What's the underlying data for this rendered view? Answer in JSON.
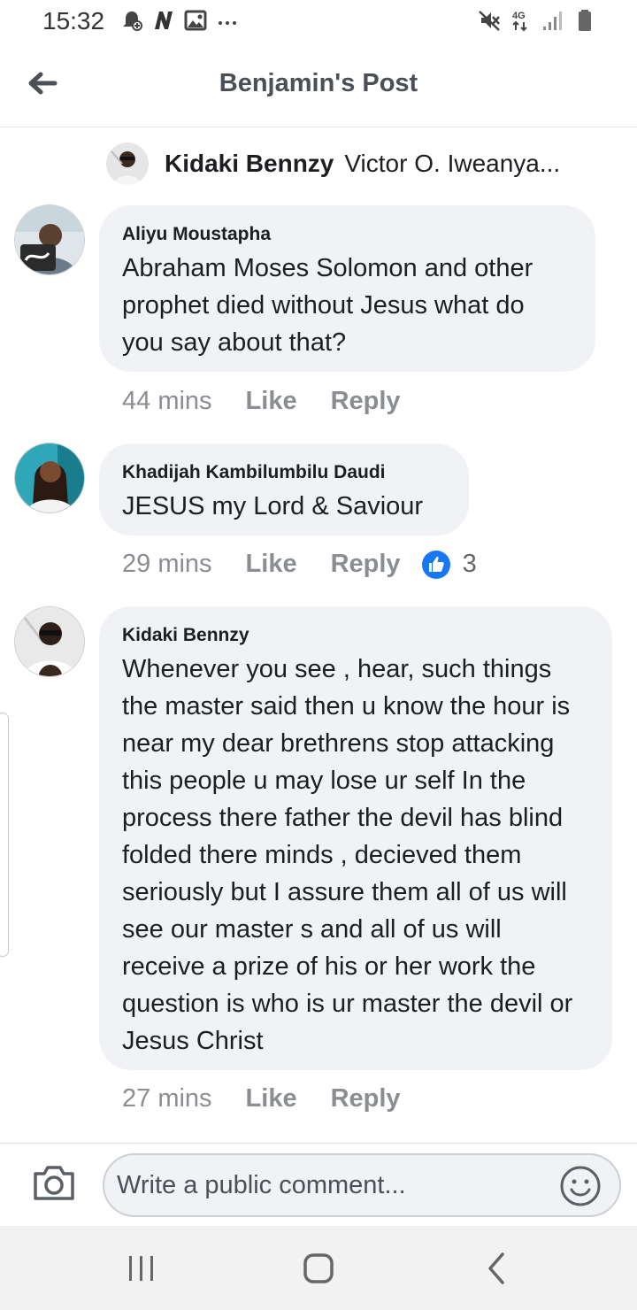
{
  "status_bar": {
    "time": "15:32",
    "left_icons": [
      "notification-icon",
      "n-logo-icon",
      "image-icon",
      "more-dots-icon"
    ],
    "right_icons": [
      "mute-icon",
      "network-4g-icon",
      "signal-icon",
      "battery-icon"
    ],
    "network_label": "4G"
  },
  "header": {
    "title": "Benjamin's Post"
  },
  "reply_preview": {
    "author": "Kidaki Bennzy",
    "text": "Victor O. Iweanya..."
  },
  "comments": [
    {
      "author": "Aliyu Moustapha",
      "text": "Abraham Moses Solomon and other prophet died without Jesus what do you say about that?",
      "time": "44 mins",
      "like_label": "Like",
      "reply_label": "Reply"
    },
    {
      "author": "Khadijah Kambilumbilu Daudi",
      "text": "JESUS my Lord & Saviour",
      "time": "29 mins",
      "like_label": "Like",
      "reply_label": "Reply",
      "reaction_count": "3"
    },
    {
      "author": "Kidaki Bennzy",
      "text": "Whenever you see , hear, such things the master said then u know the hour is near my dear brethrens stop attacking this people u may lose ur self In the process there father the devil has blind folded there minds , decieved them seriously but I assure them all of us will see our master s and all of us will receive a prize of his or her work the question is who is ur master the devil or Jesus Christ",
      "time": "27 mins",
      "like_label": "Like",
      "reply_label": "Reply"
    }
  ],
  "composer": {
    "placeholder": "Write a public comment..."
  },
  "colors": {
    "bubble": "#f0f2f5",
    "meta_text": "#8a8d91",
    "like_blue": "#1877f2"
  }
}
